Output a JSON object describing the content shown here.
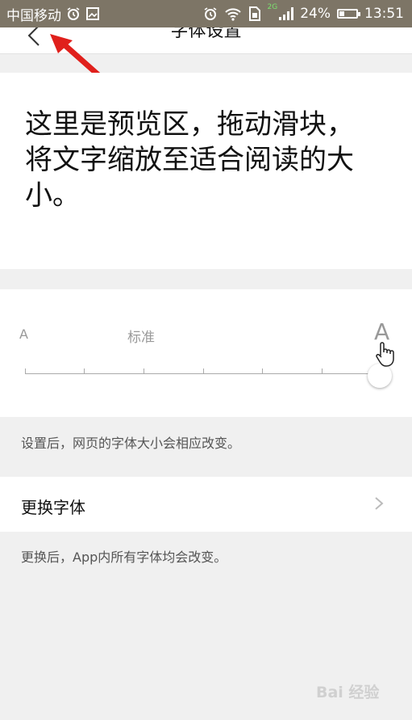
{
  "status_bar": {
    "carrier": "中国移动",
    "network_tag": "2G",
    "battery_percent": "24%",
    "time": "13:51",
    "icons": [
      "alarm-icon",
      "image-icon",
      "alarm-icon",
      "wifi-icon",
      "sim-icon",
      "signal-icon",
      "battery-icon"
    ]
  },
  "header": {
    "title": "字体设置"
  },
  "preview": {
    "text": "这里是预览区，拖动滑块，将文字缩放至适合阅读的大小。"
  },
  "font_slider": {
    "min_label": "A",
    "standard_label": "标准",
    "max_label": "A",
    "steps": 7,
    "selected_step": 7
  },
  "font_hint": "设置后，网页的字体大小会相应改变。",
  "change_font": {
    "label": "更换字体"
  },
  "change_font_hint": "更换后，App内所有字体均会改变。",
  "watermark": "Bai 经验",
  "colors": {
    "status_bar": "#7d7566",
    "background": "#f0f0f0",
    "annotation_arrow": "#e0201c"
  }
}
